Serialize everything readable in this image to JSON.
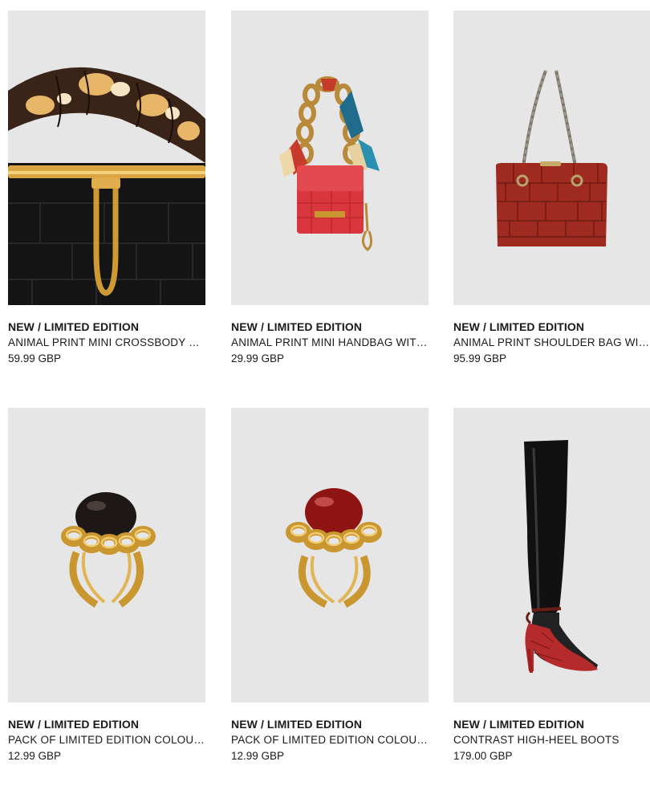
{
  "products": [
    {
      "tag": "NEW / LIMITED EDITION",
      "name": "ANIMAL PRINT MINI CROSSBODY BAG WITH SCARF",
      "price": "59.99 GBP",
      "image_icon": "black-croc-bag-scarf-handle-icon"
    },
    {
      "tag": "NEW / LIMITED EDITION",
      "name": "ANIMAL PRINT MINI HANDBAG WITH CHAIN",
      "price": "29.99 GBP",
      "image_icon": "red-mini-handbag-chain-icon"
    },
    {
      "tag": "NEW / LIMITED EDITION",
      "name": "ANIMAL PRINT SHOULDER BAG WITH CHAIN",
      "price": "95.99 GBP",
      "image_icon": "red-croc-shoulder-bag-icon"
    },
    {
      "tag": "NEW / LIMITED EDITION",
      "name": "PACK OF LIMITED EDITION COLOURED RINGS",
      "price": "12.99 GBP",
      "image_icon": "black-stone-gold-chain-ring-icon"
    },
    {
      "tag": "NEW / LIMITED EDITION",
      "name": "PACK OF LIMITED EDITION COLOURED RINGS",
      "price": "12.99 GBP",
      "image_icon": "red-stone-gold-chain-ring-icon"
    },
    {
      "tag": "NEW / LIMITED EDITION",
      "name": "CONTRAST HIGH-HEEL BOOTS",
      "price": "179.00 GBP",
      "image_icon": "black-over-knee-boot-red-heel-icon"
    }
  ],
  "colors": {
    "image_background": "#e6e6e6",
    "text": "#1a1a1a",
    "gold": "#c9962f",
    "croc_red": "#9e2a20",
    "bag_red": "#d9373d",
    "ring_red": "#8f1414"
  }
}
